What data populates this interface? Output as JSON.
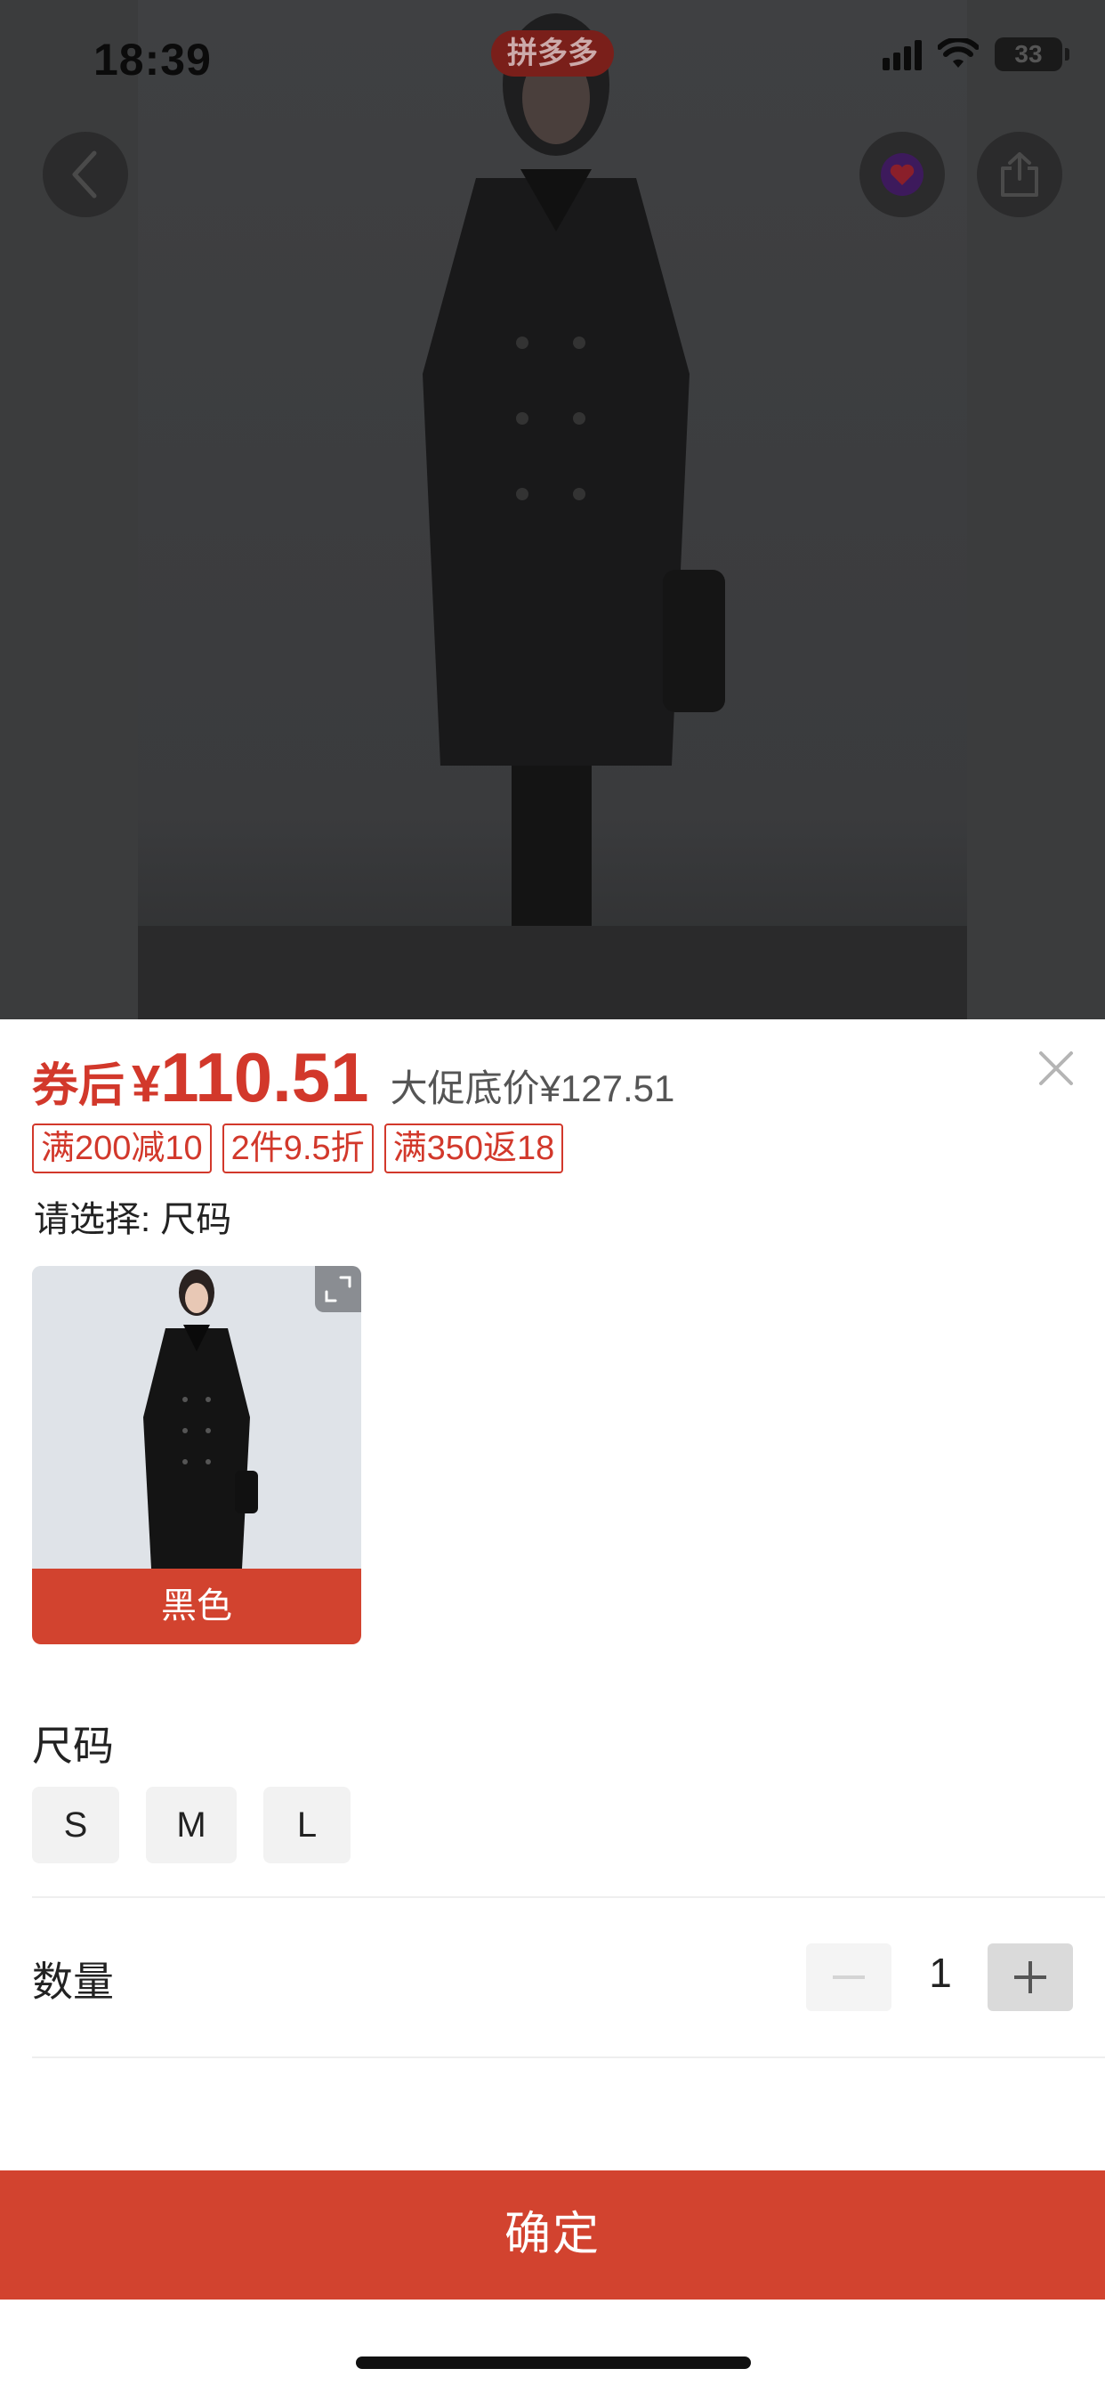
{
  "status_bar": {
    "time": "18:39",
    "battery": "33"
  },
  "hero": {
    "brand_badge": "拼多多"
  },
  "sheet": {
    "price_prefix": "券后",
    "currency": "¥",
    "price": "110.51",
    "promo_price_label": "大促底价¥127.51",
    "tags": [
      "满200减10",
      "2件9.5折",
      "满350返18"
    ],
    "select_hint": "请选择: 尺码",
    "color_option": {
      "label": "黑色"
    },
    "size_title": "尺码",
    "sizes": [
      "S",
      "M",
      "L"
    ],
    "quantity_label": "数量",
    "quantity": "1",
    "confirm_label": "确定"
  },
  "colors": {
    "accent": "#d2432f",
    "price_red": "#d2382b"
  }
}
